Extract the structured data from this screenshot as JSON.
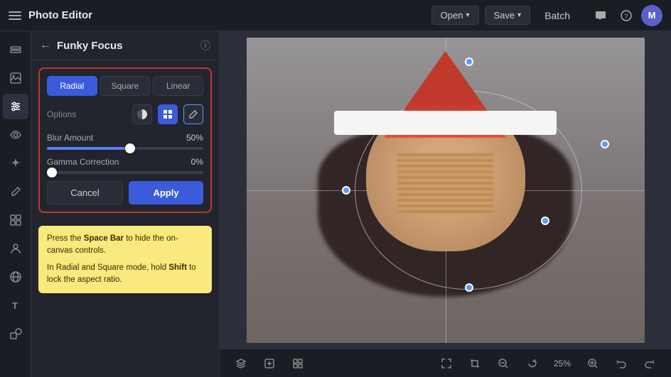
{
  "app": {
    "title": "Photo Editor",
    "avatar_initial": "M"
  },
  "navbar": {
    "open_label": "Open",
    "save_label": "Save",
    "batch_label": "Batch",
    "open_chevron": "›",
    "save_chevron": "›"
  },
  "panel": {
    "back_icon": "←",
    "title": "Funky Focus",
    "info_icon": "ⓘ",
    "mode_tabs": [
      {
        "label": "Radial",
        "active": true
      },
      {
        "label": "Square",
        "active": false
      },
      {
        "label": "Linear",
        "active": false
      }
    ],
    "options_label": "Options",
    "blur_label": "Blur Amount",
    "blur_value": "50%",
    "blur_percent": 50,
    "gamma_label": "Gamma Correction",
    "gamma_value": "0%",
    "gamma_percent": 0,
    "cancel_label": "Cancel",
    "apply_label": "Apply"
  },
  "tip": {
    "line1_prefix": "Press the ",
    "line1_key": "Space Bar",
    "line1_suffix": " to hide the on-canvas controls.",
    "line2_prefix": "In Radial and Square mode, hold ",
    "line2_key": "Shift",
    "line2_suffix": " to lock the aspect ratio."
  },
  "bottom_toolbar": {
    "zoom_value": "25%"
  },
  "sidebar_icons": [
    {
      "name": "layers-icon",
      "symbol": "⊟"
    },
    {
      "name": "image-icon",
      "symbol": "🖼"
    },
    {
      "name": "adjustments-icon",
      "symbol": "⚙"
    },
    {
      "name": "eye-icon",
      "symbol": "👁"
    },
    {
      "name": "sparkle-icon",
      "symbol": "✦"
    },
    {
      "name": "brush-icon",
      "symbol": "✏"
    },
    {
      "name": "grid-icon",
      "symbol": "⊞"
    },
    {
      "name": "person-icon",
      "symbol": "👤"
    },
    {
      "name": "globe-icon",
      "symbol": "◎"
    },
    {
      "name": "text-icon",
      "symbol": "T"
    },
    {
      "name": "shapes-icon",
      "symbol": "◻"
    }
  ]
}
